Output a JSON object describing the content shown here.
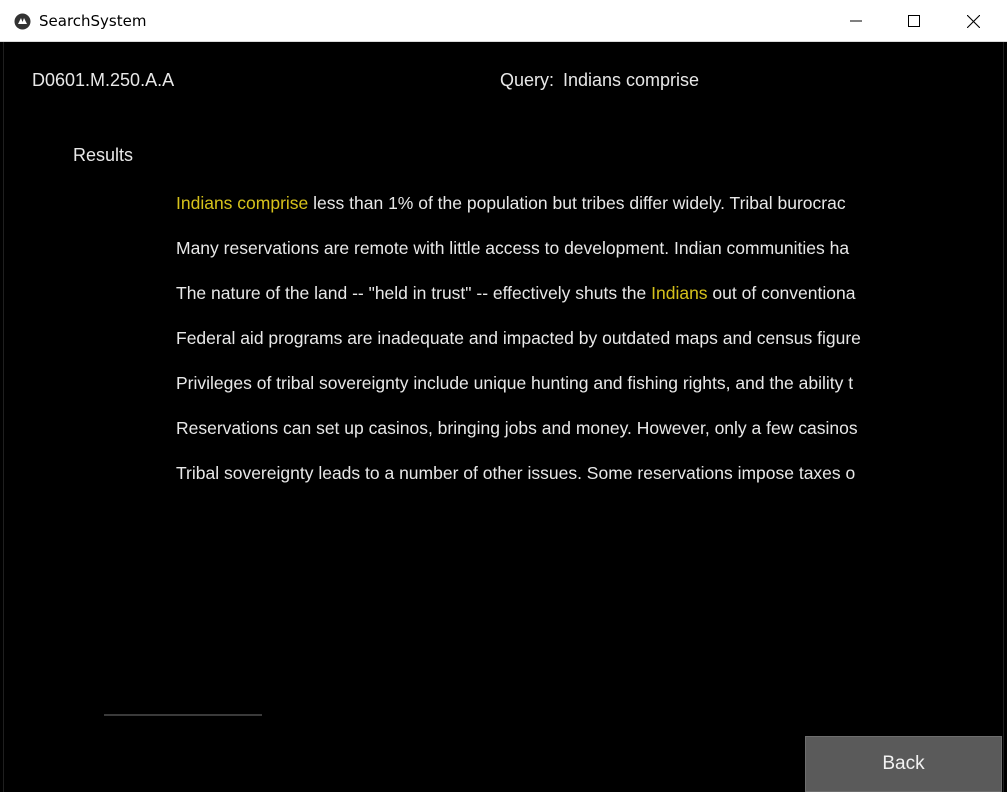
{
  "window": {
    "title": "SearchSystem",
    "icon": "kivy-logo-icon",
    "controls": [
      "minimize-icon",
      "maximize-icon",
      "close-icon"
    ]
  },
  "header": {
    "doc_id": "D0601.M.250.A.A",
    "query_label": "Query:",
    "query_value": "Indians comprise"
  },
  "results": {
    "heading": "Results",
    "highlight_color": "#d6c21b",
    "lines": [
      [
        {
          "text": " ",
          "hl": false
        },
        {
          "text": "Indians comprise",
          "hl": true
        },
        {
          "text": " less than 1% of the population but tribes differ widely. Tribal burocrac",
          "hl": false
        }
      ],
      [
        {
          "text": "Many reservations are remote with little access to development. Indian communities ha",
          "hl": false
        }
      ],
      [
        {
          "text": "The nature of the land -- \"held in trust\" -- effectively shuts the ",
          "hl": false
        },
        {
          "text": "Indians",
          "hl": true
        },
        {
          "text": " out of conventiona",
          "hl": false
        }
      ],
      [
        {
          "text": "Federal aid programs are inadequate and impacted by outdated maps and census figure",
          "hl": false
        }
      ],
      [
        {
          "text": "Privileges of tribal sovereignty include unique hunting and fishing rights, and the ability t",
          "hl": false
        }
      ],
      [
        {
          "text": "Reservations can set up casinos, bringing jobs and money. However, only a few casinos",
          "hl": false
        }
      ],
      [
        {
          "text": "Tribal sovereignty leads to a number of other issues. Some reservations impose taxes o",
          "hl": false
        }
      ]
    ]
  },
  "footer": {
    "back_label": "Back"
  }
}
